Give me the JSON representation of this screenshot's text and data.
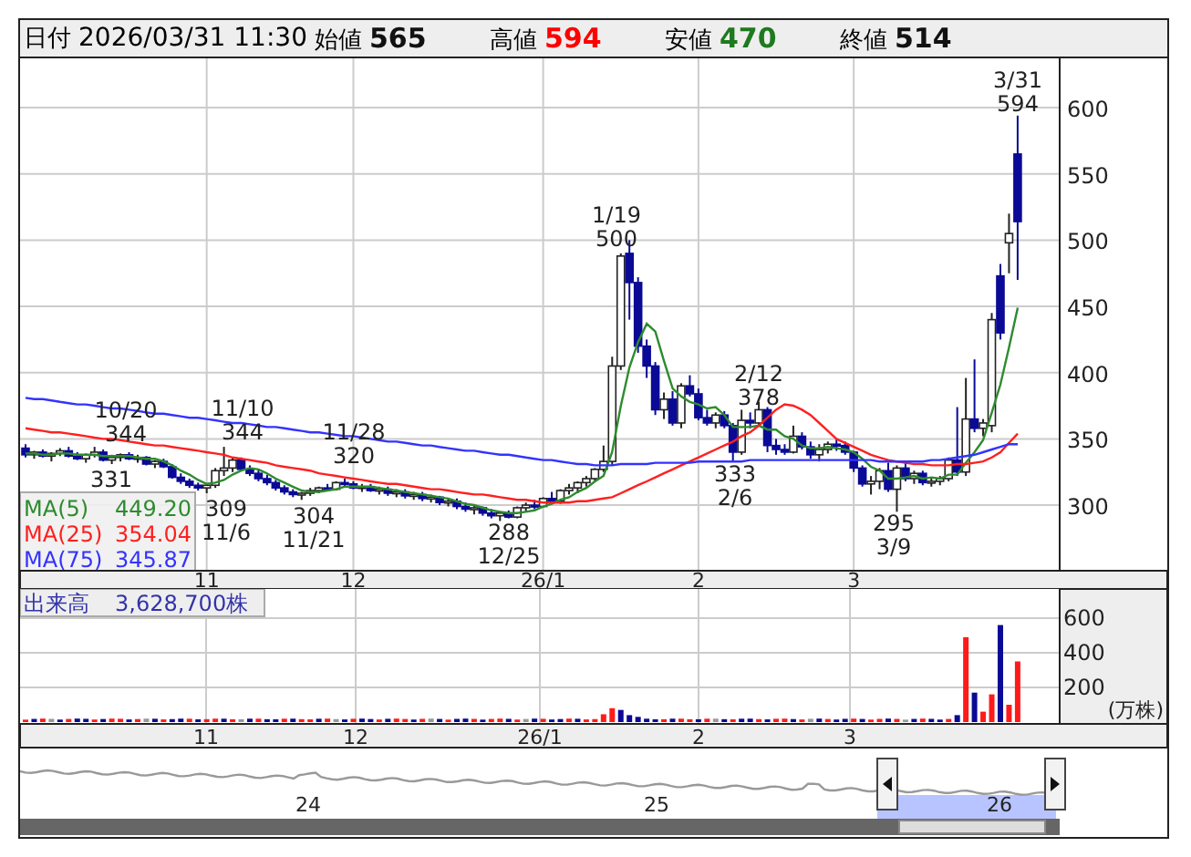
{
  "header": {
    "date_label": "日付",
    "datetime": "2026/03/31 11:30",
    "fields": [
      {
        "label": "始値",
        "value": "565",
        "color": "#111111"
      },
      {
        "label": "高値",
        "value": "594",
        "color": "#ff0000"
      },
      {
        "label": "安値",
        "value": "470",
        "color": "#1e7a1e"
      },
      {
        "label": "終値",
        "value": "514",
        "color": "#111111"
      }
    ]
  },
  "price_chart": {
    "chart_data": {
      "type": "candlestick",
      "grid": true,
      "ylim": [
        250.5,
        637.2
      ],
      "yticks": [
        600,
        550,
        500,
        450,
        400,
        350,
        300
      ],
      "categories": [
        null,
        null,
        null,
        null,
        null,
        null,
        null,
        null,
        null,
        null,
        null,
        null,
        null,
        null,
        null,
        null,
        null,
        null,
        null,
        null,
        null,
        "11",
        null,
        null,
        null,
        null,
        null,
        null,
        null,
        null,
        null,
        null,
        null,
        null,
        null,
        null,
        null,
        null,
        "12",
        null,
        null,
        null,
        null,
        null,
        null,
        null,
        null,
        null,
        null,
        null,
        null,
        null,
        null,
        null,
        null,
        null,
        null,
        null,
        null,
        null,
        "26/1",
        null,
        null,
        null,
        null,
        null,
        null,
        null,
        null,
        null,
        null,
        null,
        null,
        null,
        null,
        null,
        null,
        null,
        "2",
        null,
        null,
        null,
        null,
        null,
        null,
        null,
        null,
        null,
        null,
        null,
        null,
        null,
        null,
        null,
        null,
        null,
        "3",
        null,
        null,
        null,
        null,
        null,
        null,
        null,
        null,
        null,
        null,
        null,
        null,
        null,
        null,
        null,
        null,
        null,
        null,
        null
      ],
      "ohlc": [
        [
          343,
          346,
          336,
          338
        ],
        [
          338,
          341,
          335,
          340
        ],
        [
          340,
          342,
          336,
          337
        ],
        [
          337,
          340,
          333,
          339
        ],
        [
          339,
          343,
          337,
          341
        ],
        [
          341,
          344,
          336,
          337
        ],
        [
          337,
          340,
          334,
          335
        ],
        [
          335,
          339,
          332,
          338
        ],
        [
          338,
          344,
          336,
          340
        ],
        [
          340,
          342,
          333,
          334
        ],
        [
          334,
          338,
          331,
          336
        ],
        [
          336,
          339,
          333,
          338
        ],
        [
          338,
          340,
          334,
          335
        ],
        [
          335,
          338,
          332,
          336
        ],
        [
          336,
          337,
          330,
          331
        ],
        [
          331,
          334,
          328,
          333
        ],
        [
          333,
          335,
          328,
          329
        ],
        [
          329,
          331,
          320,
          321
        ],
        [
          321,
          324,
          316,
          318
        ],
        [
          318,
          320,
          313,
          315
        ],
        [
          315,
          317,
          311,
          313
        ],
        [
          313,
          316,
          309,
          315
        ],
        [
          315,
          328,
          313,
          326
        ],
        [
          326,
          344,
          322,
          328
        ],
        [
          328,
          336,
          325,
          334
        ],
        [
          334,
          336,
          326,
          327
        ],
        [
          327,
          330,
          322,
          324
        ],
        [
          324,
          327,
          318,
          320
        ],
        [
          320,
          323,
          315,
          317
        ],
        [
          317,
          319,
          311,
          313
        ],
        [
          313,
          315,
          308,
          310
        ],
        [
          310,
          312,
          306,
          308
        ],
        [
          308,
          310,
          304,
          309
        ],
        [
          309,
          313,
          307,
          311
        ],
        [
          311,
          314,
          309,
          313
        ],
        [
          313,
          316,
          311,
          312
        ],
        [
          312,
          318,
          311,
          317
        ],
        [
          317,
          320,
          314,
          316
        ],
        [
          316,
          318,
          312,
          313
        ],
        [
          313,
          316,
          310,
          314
        ],
        [
          314,
          316,
          310,
          311
        ],
        [
          311,
          314,
          308,
          312
        ],
        [
          312,
          314,
          307,
          309
        ],
        [
          309,
          312,
          306,
          310
        ],
        [
          310,
          312,
          305,
          307
        ],
        [
          307,
          310,
          304,
          308
        ],
        [
          308,
          310,
          303,
          305
        ],
        [
          305,
          308,
          302,
          306
        ],
        [
          306,
          307,
          300,
          302
        ],
        [
          302,
          305,
          299,
          303
        ],
        [
          303,
          305,
          297,
          299
        ],
        [
          299,
          302,
          295,
          297
        ],
        [
          297,
          300,
          293,
          298
        ],
        [
          298,
          299,
          292,
          294
        ],
        [
          294,
          297,
          290,
          292
        ],
        [
          292,
          295,
          288,
          294
        ],
        [
          294,
          296,
          290,
          291
        ],
        [
          291,
          299,
          290,
          298
        ],
        [
          298,
          302,
          295,
          300
        ],
        [
          300,
          304,
          297,
          299
        ],
        [
          299,
          306,
          298,
          305
        ],
        [
          305,
          310,
          302,
          303
        ],
        [
          303,
          312,
          301,
          311
        ],
        [
          311,
          316,
          308,
          313
        ],
        [
          313,
          318,
          309,
          317
        ],
        [
          317,
          322,
          314,
          320
        ],
        [
          320,
          328,
          318,
          327
        ],
        [
          327,
          345,
          325,
          333
        ],
        [
          333,
          412,
          330,
          405
        ],
        [
          405,
          490,
          402,
          488
        ],
        [
          490,
          500,
          440,
          468
        ],
        [
          468,
          472,
          415,
          420
        ],
        [
          420,
          425,
          396,
          405
        ],
        [
          405,
          408,
          368,
          372
        ],
        [
          372,
          385,
          365,
          380
        ],
        [
          380,
          386,
          360,
          362
        ],
        [
          362,
          392,
          358,
          390
        ],
        [
          390,
          398,
          382,
          384
        ],
        [
          384,
          388,
          364,
          366
        ],
        [
          366,
          372,
          360,
          362
        ],
        [
          362,
          370,
          358,
          368
        ],
        [
          368,
          371,
          358,
          360
        ],
        [
          360,
          362,
          333,
          340
        ],
        [
          340,
          372,
          338,
          364
        ],
        [
          364,
          370,
          358,
          362
        ],
        [
          362,
          378,
          360,
          372
        ],
        [
          372,
          374,
          340,
          345
        ],
        [
          345,
          350,
          338,
          342
        ],
        [
          342,
          346,
          338,
          340
        ],
        [
          340,
          360,
          339,
          352
        ],
        [
          352,
          355,
          342,
          344
        ],
        [
          344,
          348,
          335,
          338
        ],
        [
          338,
          346,
          333,
          342
        ],
        [
          342,
          348,
          339,
          346
        ],
        [
          346,
          350,
          341,
          345
        ],
        [
          345,
          348,
          338,
          340
        ],
        [
          340,
          341,
          325,
          328
        ],
        [
          328,
          330,
          314,
          316
        ],
        [
          316,
          322,
          308,
          318
        ],
        [
          318,
          328,
          312,
          326
        ],
        [
          326,
          332,
          310,
          312
        ],
        [
          312,
          330,
          295,
          328
        ],
        [
          328,
          332,
          318,
          320
        ],
        [
          320,
          326,
          316,
          324
        ],
        [
          324,
          326,
          315,
          317
        ],
        [
          317,
          320,
          314,
          318
        ],
        [
          318,
          322,
          315,
          320
        ],
        [
          320,
          336,
          318,
          334
        ],
        [
          334,
          374,
          322,
          325
        ],
        [
          325,
          396,
          322,
          365
        ],
        [
          365,
          410,
          355,
          358
        ],
        [
          358,
          365,
          352,
          362
        ],
        [
          360,
          445,
          355,
          440
        ],
        [
          473,
          482,
          425,
          430
        ],
        [
          498,
          520,
          475,
          505
        ],
        [
          565,
          594,
          470,
          514
        ]
      ],
      "series": [
        {
          "name": "MA(5)",
          "type": "line",
          "color": "#2e8b2e",
          "values": [
            339,
            339,
            338,
            338,
            339,
            339,
            338,
            338,
            338,
            337,
            337,
            337,
            337,
            336,
            335,
            335,
            333,
            330,
            326,
            323,
            319,
            316,
            317,
            319,
            323,
            326,
            328,
            327,
            324,
            320,
            317,
            314,
            311,
            310,
            310,
            311,
            312,
            314,
            314,
            314,
            314,
            313,
            312,
            311,
            310,
            309,
            308,
            307,
            306,
            305,
            303,
            301,
            300,
            298,
            296,
            295,
            294,
            294,
            295,
            296,
            299,
            301,
            304,
            306,
            310,
            313,
            318,
            322,
            340,
            375,
            404,
            423,
            437,
            431,
            409,
            388,
            382,
            378,
            376,
            373,
            374,
            368,
            359,
            359,
            359,
            360,
            357,
            357,
            352,
            350,
            345,
            343,
            343,
            344,
            343,
            342,
            340,
            335,
            329,
            326,
            320,
            320,
            321,
            322,
            320,
            321,
            320,
            323,
            323,
            332,
            340,
            349,
            370,
            391,
            419,
            449
          ]
        },
        {
          "name": "MA(25)",
          "type": "line",
          "color": "#ff2020",
          "values": [
            358,
            357,
            356,
            355,
            355,
            354,
            353,
            352,
            351,
            350,
            350,
            349,
            348,
            347,
            346,
            345,
            345,
            344,
            343,
            342,
            341,
            340,
            339,
            338,
            336,
            335,
            334,
            333,
            332,
            330,
            329,
            328,
            327,
            326,
            324,
            323,
            322,
            321,
            320,
            319,
            318,
            317,
            316,
            316,
            315,
            314,
            313,
            312,
            312,
            311,
            310,
            309,
            308,
            308,
            307,
            306,
            305,
            304,
            304,
            303,
            302,
            302,
            302,
            302,
            303,
            303,
            304,
            305,
            306,
            309,
            312,
            315,
            318,
            321,
            324,
            327,
            330,
            333,
            336,
            339,
            342,
            345,
            348,
            352,
            355,
            360,
            366,
            372,
            376,
            375,
            372,
            368,
            362,
            356,
            350,
            347,
            344,
            341,
            338,
            336,
            334,
            333,
            332,
            331,
            331,
            330,
            330,
            330,
            331,
            331,
            332,
            333,
            336,
            340,
            347,
            354
          ]
        },
        {
          "name": "MA(75)",
          "type": "line",
          "color": "#3333ff",
          "values": [
            381,
            380,
            380,
            379,
            378,
            377,
            376,
            376,
            375,
            374,
            373,
            373,
            372,
            371,
            370,
            369,
            369,
            368,
            367,
            366,
            366,
            365,
            364,
            363,
            362,
            362,
            361,
            360,
            359,
            359,
            358,
            357,
            356,
            355,
            355,
            354,
            353,
            352,
            352,
            351,
            350,
            349,
            348,
            348,
            347,
            346,
            345,
            345,
            344,
            343,
            342,
            341,
            341,
            340,
            339,
            338,
            338,
            337,
            336,
            335,
            334,
            334,
            333,
            332,
            331,
            331,
            330,
            330,
            330,
            331,
            331,
            331,
            331,
            332,
            332,
            332,
            332,
            332,
            333,
            333,
            333,
            333,
            333,
            333,
            334,
            334,
            334,
            334,
            334,
            334,
            334,
            334,
            334,
            334,
            334,
            334,
            334,
            334,
            334,
            333,
            333,
            333,
            333,
            333,
            333,
            334,
            334,
            335,
            336,
            337,
            338,
            340,
            342,
            344,
            346,
            346
          ]
        }
      ]
    },
    "annotations": [
      {
        "lines": [
          "10/20",
          "344"
        ]
      },
      {
        "lines": [
          "331"
        ]
      },
      {
        "lines": [
          "11/10",
          "344"
        ]
      },
      {
        "lines": [
          "309",
          "11/6"
        ]
      },
      {
        "lines": [
          "304",
          "11/21"
        ]
      },
      {
        "lines": [
          "11/28",
          "320"
        ]
      },
      {
        "lines": [
          "288",
          "12/25"
        ]
      },
      {
        "lines": [
          "1/19",
          "500"
        ]
      },
      {
        "lines": [
          "2/12",
          "378"
        ]
      },
      {
        "lines": [
          "333",
          "2/6"
        ]
      },
      {
        "lines": [
          "295",
          "3/9"
        ]
      },
      {
        "lines": [
          "3/31",
          "594"
        ]
      }
    ],
    "legend": [
      {
        "value": "449.20"
      },
      {
        "value": "354.04"
      },
      {
        "value": "345.87"
      }
    ]
  },
  "volume_chart": {
    "label": "出来高",
    "total": "3,628,700株",
    "y_ticks": [
      "600",
      "400",
      "200"
    ],
    "unit": "(万株)",
    "x_labels": [
      "11",
      "12",
      "26/1",
      "2",
      "3"
    ]
  },
  "navigator": {
    "year_labels": [
      "24",
      "25",
      "26"
    ]
  }
}
